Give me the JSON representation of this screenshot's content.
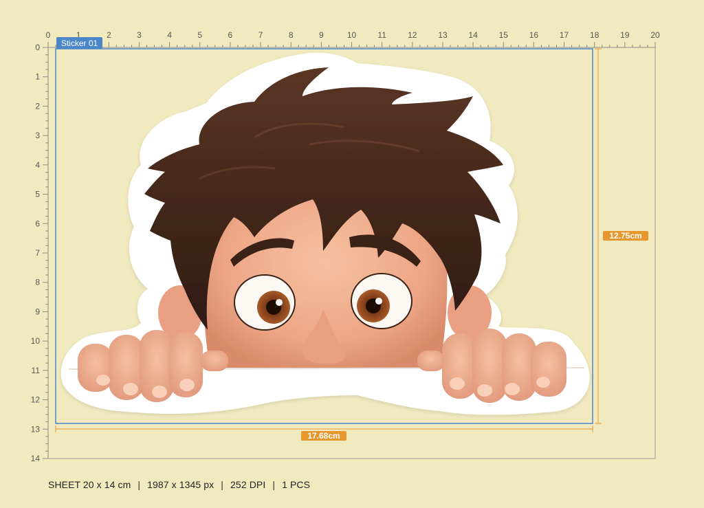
{
  "sheet": {
    "width_cm": 20,
    "height_cm": 14,
    "x_ticks": [
      "0",
      "1",
      "2",
      "3",
      "4",
      "5",
      "6",
      "7",
      "8",
      "9",
      "10",
      "11",
      "12",
      "13",
      "14",
      "15",
      "16",
      "17",
      "18",
      "19",
      "20"
    ],
    "y_ticks": [
      "0",
      "1",
      "2",
      "3",
      "4",
      "5",
      "6",
      "7",
      "8",
      "9",
      "10",
      "11",
      "12",
      "13",
      "14"
    ]
  },
  "sticker": {
    "label": "Sticker 01",
    "selection_color": "#4a86c8",
    "dimension_color": "#e8962e",
    "width_label": "17.68cm",
    "height_label": "12.75cm"
  },
  "footer": {
    "size": "SHEET 20 x 14 cm",
    "pixels": "1987 x 1345 px",
    "dpi": "252 DPI",
    "count": "1 PCS",
    "separator": "|"
  },
  "colors": {
    "background": "#f2eabf",
    "ruler": "#8a8a8a"
  }
}
